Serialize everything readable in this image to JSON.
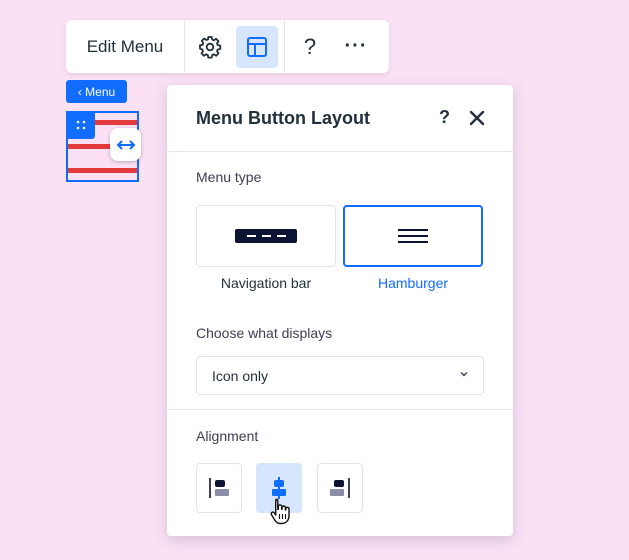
{
  "toolbar": {
    "edit_label": "Edit Menu",
    "icons": [
      "gear-icon",
      "layout-icon",
      "help-icon",
      "more-icon"
    ],
    "help_glyph": "?",
    "more_glyph": "···"
  },
  "menu_tag": {
    "label": "‹ Menu"
  },
  "panel": {
    "title": "Menu Button Layout",
    "help_glyph": "?",
    "menu_type_label": "Menu type",
    "menu_types": [
      {
        "label": "Navigation bar",
        "selected": false
      },
      {
        "label": "Hamburger",
        "selected": true
      }
    ],
    "display_label": "Choose what displays",
    "display_value": "Icon only",
    "alignment_label": "Alignment",
    "alignment_options": [
      "align-left",
      "align-center",
      "align-right"
    ],
    "alignment_selected": "align-center"
  },
  "colors": {
    "background": "#fce1f5",
    "accent": "#116dff",
    "accent_light": "#d6e6fe",
    "menu_stripe": "#e33b3b",
    "text": "#20303c"
  }
}
